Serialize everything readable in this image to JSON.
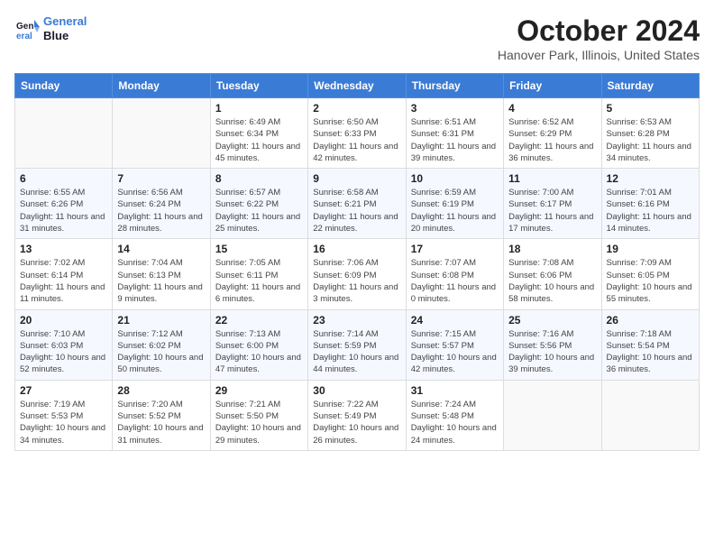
{
  "header": {
    "logo_line1": "General",
    "logo_line2": "Blue",
    "month": "October 2024",
    "location": "Hanover Park, Illinois, United States"
  },
  "days_of_week": [
    "Sunday",
    "Monday",
    "Tuesday",
    "Wednesday",
    "Thursday",
    "Friday",
    "Saturday"
  ],
  "weeks": [
    [
      {
        "day": "",
        "info": ""
      },
      {
        "day": "",
        "info": ""
      },
      {
        "day": "1",
        "info": "Sunrise: 6:49 AM\nSunset: 6:34 PM\nDaylight: 11 hours and 45 minutes."
      },
      {
        "day": "2",
        "info": "Sunrise: 6:50 AM\nSunset: 6:33 PM\nDaylight: 11 hours and 42 minutes."
      },
      {
        "day": "3",
        "info": "Sunrise: 6:51 AM\nSunset: 6:31 PM\nDaylight: 11 hours and 39 minutes."
      },
      {
        "day": "4",
        "info": "Sunrise: 6:52 AM\nSunset: 6:29 PM\nDaylight: 11 hours and 36 minutes."
      },
      {
        "day": "5",
        "info": "Sunrise: 6:53 AM\nSunset: 6:28 PM\nDaylight: 11 hours and 34 minutes."
      }
    ],
    [
      {
        "day": "6",
        "info": "Sunrise: 6:55 AM\nSunset: 6:26 PM\nDaylight: 11 hours and 31 minutes."
      },
      {
        "day": "7",
        "info": "Sunrise: 6:56 AM\nSunset: 6:24 PM\nDaylight: 11 hours and 28 minutes."
      },
      {
        "day": "8",
        "info": "Sunrise: 6:57 AM\nSunset: 6:22 PM\nDaylight: 11 hours and 25 minutes."
      },
      {
        "day": "9",
        "info": "Sunrise: 6:58 AM\nSunset: 6:21 PM\nDaylight: 11 hours and 22 minutes."
      },
      {
        "day": "10",
        "info": "Sunrise: 6:59 AM\nSunset: 6:19 PM\nDaylight: 11 hours and 20 minutes."
      },
      {
        "day": "11",
        "info": "Sunrise: 7:00 AM\nSunset: 6:17 PM\nDaylight: 11 hours and 17 minutes."
      },
      {
        "day": "12",
        "info": "Sunrise: 7:01 AM\nSunset: 6:16 PM\nDaylight: 11 hours and 14 minutes."
      }
    ],
    [
      {
        "day": "13",
        "info": "Sunrise: 7:02 AM\nSunset: 6:14 PM\nDaylight: 11 hours and 11 minutes."
      },
      {
        "day": "14",
        "info": "Sunrise: 7:04 AM\nSunset: 6:13 PM\nDaylight: 11 hours and 9 minutes."
      },
      {
        "day": "15",
        "info": "Sunrise: 7:05 AM\nSunset: 6:11 PM\nDaylight: 11 hours and 6 minutes."
      },
      {
        "day": "16",
        "info": "Sunrise: 7:06 AM\nSunset: 6:09 PM\nDaylight: 11 hours and 3 minutes."
      },
      {
        "day": "17",
        "info": "Sunrise: 7:07 AM\nSunset: 6:08 PM\nDaylight: 11 hours and 0 minutes."
      },
      {
        "day": "18",
        "info": "Sunrise: 7:08 AM\nSunset: 6:06 PM\nDaylight: 10 hours and 58 minutes."
      },
      {
        "day": "19",
        "info": "Sunrise: 7:09 AM\nSunset: 6:05 PM\nDaylight: 10 hours and 55 minutes."
      }
    ],
    [
      {
        "day": "20",
        "info": "Sunrise: 7:10 AM\nSunset: 6:03 PM\nDaylight: 10 hours and 52 minutes."
      },
      {
        "day": "21",
        "info": "Sunrise: 7:12 AM\nSunset: 6:02 PM\nDaylight: 10 hours and 50 minutes."
      },
      {
        "day": "22",
        "info": "Sunrise: 7:13 AM\nSunset: 6:00 PM\nDaylight: 10 hours and 47 minutes."
      },
      {
        "day": "23",
        "info": "Sunrise: 7:14 AM\nSunset: 5:59 PM\nDaylight: 10 hours and 44 minutes."
      },
      {
        "day": "24",
        "info": "Sunrise: 7:15 AM\nSunset: 5:57 PM\nDaylight: 10 hours and 42 minutes."
      },
      {
        "day": "25",
        "info": "Sunrise: 7:16 AM\nSunset: 5:56 PM\nDaylight: 10 hours and 39 minutes."
      },
      {
        "day": "26",
        "info": "Sunrise: 7:18 AM\nSunset: 5:54 PM\nDaylight: 10 hours and 36 minutes."
      }
    ],
    [
      {
        "day": "27",
        "info": "Sunrise: 7:19 AM\nSunset: 5:53 PM\nDaylight: 10 hours and 34 minutes."
      },
      {
        "day": "28",
        "info": "Sunrise: 7:20 AM\nSunset: 5:52 PM\nDaylight: 10 hours and 31 minutes."
      },
      {
        "day": "29",
        "info": "Sunrise: 7:21 AM\nSunset: 5:50 PM\nDaylight: 10 hours and 29 minutes."
      },
      {
        "day": "30",
        "info": "Sunrise: 7:22 AM\nSunset: 5:49 PM\nDaylight: 10 hours and 26 minutes."
      },
      {
        "day": "31",
        "info": "Sunrise: 7:24 AM\nSunset: 5:48 PM\nDaylight: 10 hours and 24 minutes."
      },
      {
        "day": "",
        "info": ""
      },
      {
        "day": "",
        "info": ""
      }
    ]
  ]
}
